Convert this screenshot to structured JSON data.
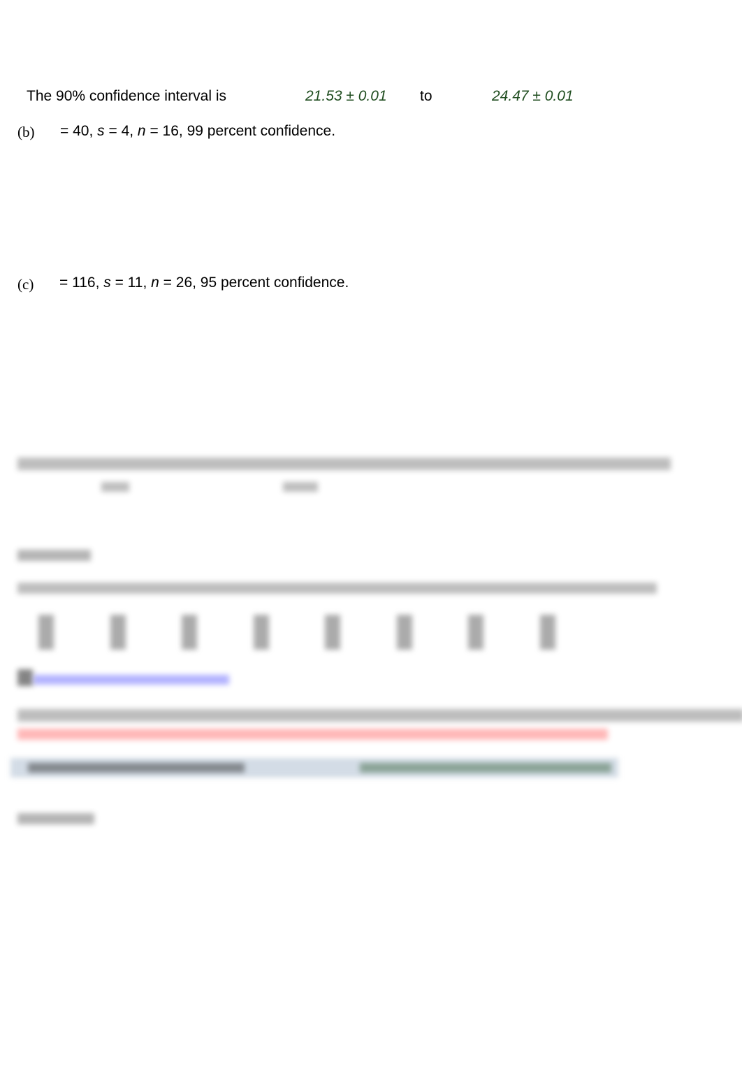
{
  "part_a": {
    "label": "The 90% confidence interval is",
    "lower": "21.53 ± 0.01",
    "to": "to",
    "upper": "24.47 ± 0.01"
  },
  "part_b": {
    "marker": "(b)",
    "prefix": "= 40, ",
    "s_var": "s",
    "s_val": " = 4, ",
    "n_var": "n",
    "rest": " = 16, 99 percent confidence."
  },
  "part_c": {
    "marker": "(c)",
    "prefix": "= 116, ",
    "s_var": "s",
    "s_val": " = 11, ",
    "n_var": "n",
    "rest": " = 26, 95 percent confidence."
  },
  "colors": {
    "answer_green": "#1f4d1f",
    "link_blue": "#6666ff",
    "warning_red": "#ff3333",
    "answer_box": "#d3dce6"
  }
}
